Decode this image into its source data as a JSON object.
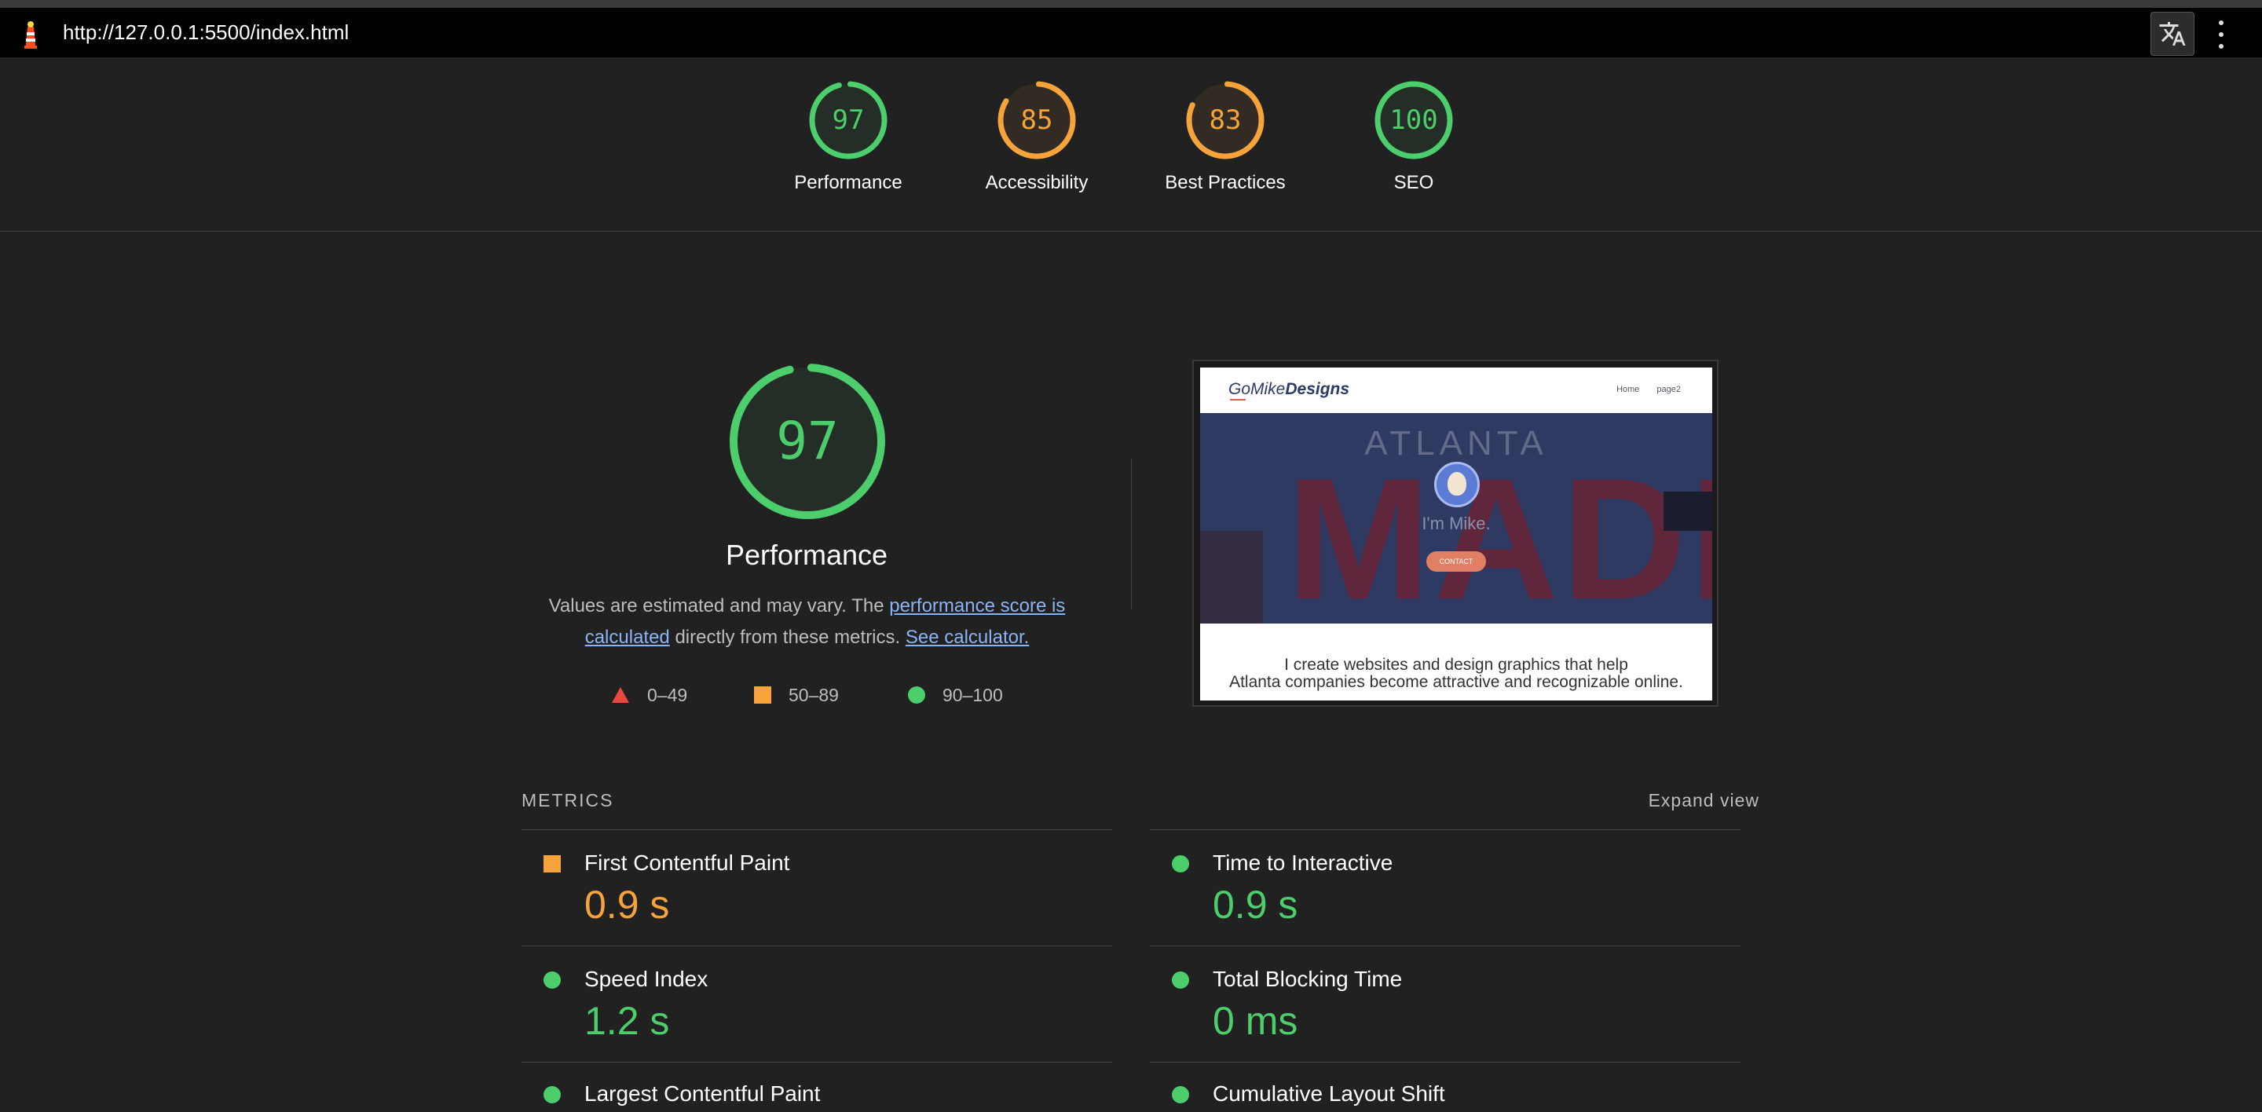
{
  "browser": {
    "url": "http://127.0.0.1:5500/index.html"
  },
  "scores": [
    {
      "value": "97",
      "label": "Performance",
      "fraction": 0.97,
      "color": "#4cce6c"
    },
    {
      "value": "85",
      "label": "Accessibility",
      "fraction": 0.85,
      "color": "#f5a33a"
    },
    {
      "value": "83",
      "label": "Best Practices",
      "fraction": 0.83,
      "color": "#f5a33a"
    },
    {
      "value": "100",
      "label": "SEO",
      "fraction": 1.0,
      "color": "#4cce6c"
    }
  ],
  "performance": {
    "score": "97",
    "fraction": 0.97,
    "title": "Performance",
    "desc_before": "Values are estimated and may vary. The ",
    "link_score": "performance score is calculated",
    "desc_middle": " directly from these metrics. ",
    "link_calc": "See calculator.",
    "scale": {
      "fail": "0–49",
      "average": "50–89",
      "pass": "90–100"
    }
  },
  "screenshot": {
    "logo_light": "GoMike",
    "logo_bold": "Designs",
    "nav_home": "Home",
    "nav_page2": "page2",
    "hero_top": "ATLANTA",
    "hero_big": "MADE",
    "hero_greeting": "I'm Mike.",
    "hero_button": "CONTACT",
    "tagline_1": "I create websites and design graphics that help",
    "tagline_2": "Atlanta companies become attractive and recognizable online."
  },
  "metrics": {
    "title": "METRICS",
    "expand": "Expand view",
    "items": [
      {
        "name": "First Contentful Paint",
        "value": "0.9 s",
        "rating": "average"
      },
      {
        "name": "Time to Interactive",
        "value": "0.9 s",
        "rating": "pass"
      },
      {
        "name": "Speed Index",
        "value": "1.2 s",
        "rating": "pass"
      },
      {
        "name": "Total Blocking Time",
        "value": "0 ms",
        "rating": "pass"
      },
      {
        "name": "Largest Contentful Paint",
        "value": "",
        "rating": "pass"
      },
      {
        "name": "Cumulative Layout Shift",
        "value": "",
        "rating": "pass"
      }
    ]
  },
  "colors": {
    "pass": "#4cce6c",
    "average": "#f5a33a",
    "fail": "#e84a3f"
  }
}
